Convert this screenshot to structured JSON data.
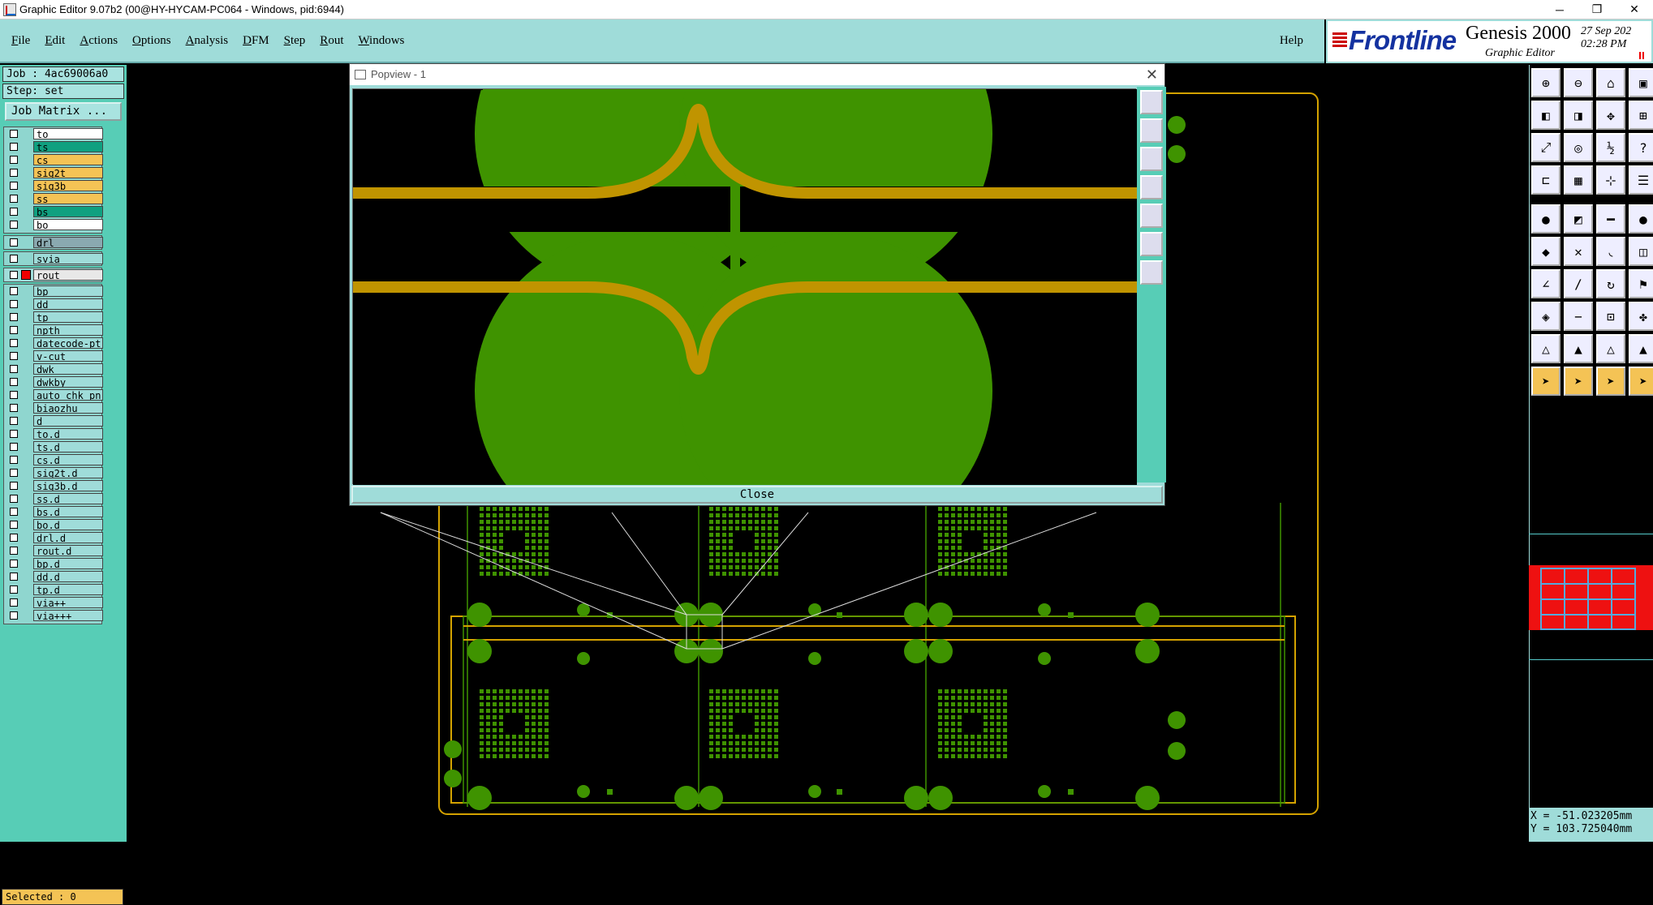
{
  "window": {
    "title": "Graphic Editor 9.07b2 (00@HY-HYCAM-PC064 - Windows, pid:6944)",
    "minimize": "─",
    "restore": "❐",
    "close": "✕"
  },
  "menu": {
    "items": [
      "File",
      "Edit",
      "Actions",
      "Options",
      "Analysis",
      "DFM",
      "Step",
      "Rout",
      "Windows"
    ],
    "help": "Help"
  },
  "logo": {
    "brand": "Frontline",
    "product": "Genesis 2000",
    "subtitle": "Graphic Editor",
    "date": "27 Sep 202",
    "time": "02:28 PM"
  },
  "left": {
    "job": "Job : 4ac69006a0",
    "step": "Step: set",
    "job_matrix": "Job Matrix ..."
  },
  "layers_top": [
    {
      "name": "to",
      "color": "#ffffff"
    },
    {
      "name": "ts",
      "color": "#10a080"
    },
    {
      "name": "cs",
      "color": "#f4c355"
    },
    {
      "name": "sig2t",
      "color": "#f4c355"
    },
    {
      "name": "sig3b",
      "color": "#f4c355"
    },
    {
      "name": "ss",
      "color": "#f4c355"
    },
    {
      "name": "bs",
      "color": "#10a080"
    },
    {
      "name": "bo",
      "color": "#ffffff"
    }
  ],
  "layer_drl": {
    "name": "drl",
    "color": "#8aa9b0"
  },
  "layer_svia": {
    "name": "svia",
    "color": "#9fdcd9"
  },
  "layer_rout": {
    "name": "rout",
    "color": "#e8e8e8"
  },
  "layers_misc": [
    "bp",
    "dd",
    "tp",
    "npth",
    "datecode-pt",
    "v-cut",
    "dwk",
    "dwkby",
    "auto_chk_pn",
    "biaozhu",
    "d",
    "to.d",
    "ts.d",
    "cs.d",
    "sig2t.d",
    "sig3b.d",
    "ss.d",
    "bs.d",
    "bo.d",
    "drl.d",
    "rout.d",
    "bp.d",
    "dd.d",
    "tp.d",
    "via++",
    "via+++"
  ],
  "status": {
    "selected": "Selected : 0"
  },
  "popup": {
    "title": "Popview - 1",
    "close_label": "Close",
    "close_x": "✕"
  },
  "coords": {
    "x": "X = -51.023205mm",
    "y": "Y = 103.725040mm"
  },
  "colors": {
    "pad": "#3f9300",
    "trace": "#c09400",
    "outline": "#d4a200",
    "panel_teal": "#9fdcd9",
    "overview_red": "#ee1111"
  },
  "toolbar_icons": [
    "zoom-in-icon",
    "zoom-out-icon",
    "home-icon",
    "zoom-window-icon",
    "pan-left-icon",
    "pan-right-icon",
    "pan-icon",
    "zoom-area-icon",
    "fit-icon",
    "center-icon",
    "scale-1-2-icon",
    "help-icon",
    "measure-icon",
    "grid-icon",
    "snap-icon",
    "layers-icon",
    "pad-icon",
    "polygon-icon",
    "line-icon",
    "circle-icon",
    "select-icon",
    "cross-icon",
    "arc-icon",
    "mirror-icon",
    "angle-icon",
    "slash-icon",
    "rotate-icon",
    "flag-icon",
    "node-icon",
    "minus-icon",
    "box-icon",
    "cluster-icon",
    "triangle-icon",
    "triangle-a-icon",
    "triangle-b-icon",
    "triangle-c-icon",
    "pointer-icon",
    "pointer-select-icon",
    "pointer-node-icon",
    "pointer-drag-icon"
  ]
}
